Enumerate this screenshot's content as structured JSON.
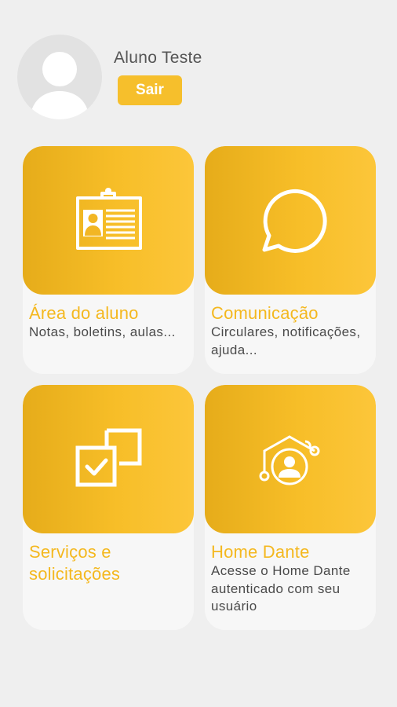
{
  "profile": {
    "name": "Aluno Teste",
    "logout_label": "Sair",
    "avatar_icon": "user-placeholder-icon"
  },
  "colors": {
    "accent": "#f6bf2c",
    "card_gradient_start": "#e6ac1a",
    "card_gradient_end": "#fcc63a",
    "title": "#f4b81f",
    "background": "#efefef"
  },
  "menu": [
    {
      "title": "Área do aluno",
      "description": "Notas, boletins, aulas...",
      "icon": "student-id-card-icon"
    },
    {
      "title": "Comunicação",
      "description": "Circulares, notificações, ajuda...",
      "icon": "chat-bubble-icon"
    },
    {
      "title": "Serviços e solicitações",
      "description": "",
      "icon": "checkbox-squares-icon"
    },
    {
      "title": "Home Dante",
      "description": "Acesse o Home Dante autenticado com seu usuário",
      "icon": "user-network-icon"
    }
  ]
}
